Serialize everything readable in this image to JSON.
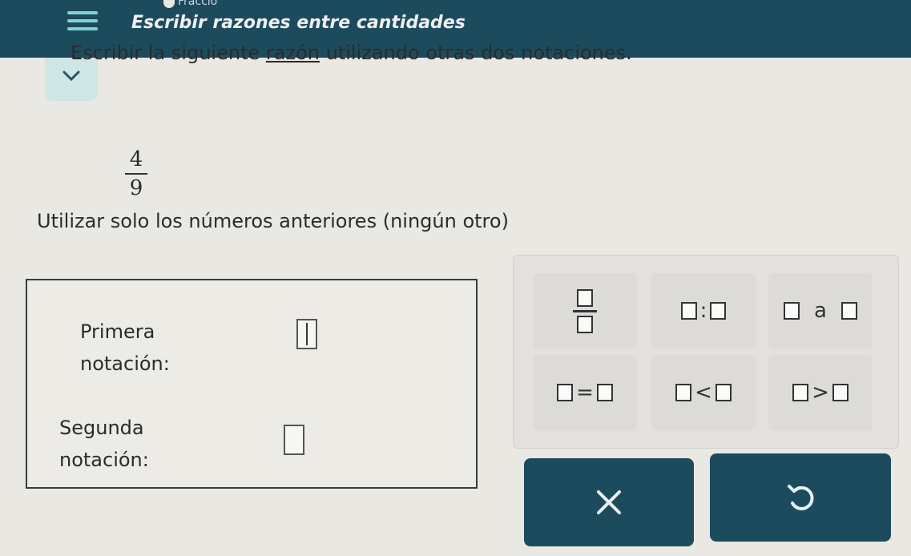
{
  "header": {
    "topic": "Fraccio",
    "title": "Escribir razones entre cantidades"
  },
  "problem": {
    "instruction_before": "Escribir la siguiente ",
    "instruction_link": "razón",
    "instruction_after": " utilizando otras dos notaciones.",
    "ratio_numerator": "4",
    "ratio_denominator": "9",
    "constraint": "Utilizar solo los números anteriores (ningún otro)"
  },
  "answers": {
    "first_label_line1": "Primera",
    "first_label_line2": "notación:",
    "first_value": "",
    "second_label_line1": "Segunda",
    "second_label_line2": "notación:",
    "second_value": ""
  },
  "keypad": {
    "colon": ":",
    "a_word": "a",
    "equals": "=",
    "less": "<",
    "greater": ">"
  },
  "buttons": {
    "clear_symbol": "✕",
    "undo_symbol": "↶"
  },
  "colors": {
    "header_bg": "#1d4b5e",
    "accent": "#7fd3d5",
    "button_bg": "#1d4b5e"
  }
}
